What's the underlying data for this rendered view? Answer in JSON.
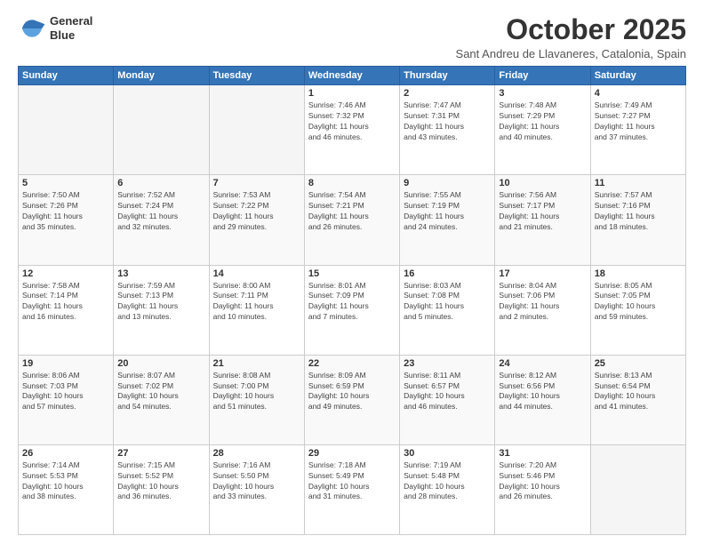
{
  "header": {
    "logo_line1": "General",
    "logo_line2": "Blue",
    "month": "October 2025",
    "location": "Sant Andreu de Llavaneres, Catalonia, Spain"
  },
  "weekdays": [
    "Sunday",
    "Monday",
    "Tuesday",
    "Wednesday",
    "Thursday",
    "Friday",
    "Saturday"
  ],
  "weeks": [
    [
      {
        "day": "",
        "info": ""
      },
      {
        "day": "",
        "info": ""
      },
      {
        "day": "",
        "info": ""
      },
      {
        "day": "1",
        "info": "Sunrise: 7:46 AM\nSunset: 7:32 PM\nDaylight: 11 hours\nand 46 minutes."
      },
      {
        "day": "2",
        "info": "Sunrise: 7:47 AM\nSunset: 7:31 PM\nDaylight: 11 hours\nand 43 minutes."
      },
      {
        "day": "3",
        "info": "Sunrise: 7:48 AM\nSunset: 7:29 PM\nDaylight: 11 hours\nand 40 minutes."
      },
      {
        "day": "4",
        "info": "Sunrise: 7:49 AM\nSunset: 7:27 PM\nDaylight: 11 hours\nand 37 minutes."
      }
    ],
    [
      {
        "day": "5",
        "info": "Sunrise: 7:50 AM\nSunset: 7:26 PM\nDaylight: 11 hours\nand 35 minutes."
      },
      {
        "day": "6",
        "info": "Sunrise: 7:52 AM\nSunset: 7:24 PM\nDaylight: 11 hours\nand 32 minutes."
      },
      {
        "day": "7",
        "info": "Sunrise: 7:53 AM\nSunset: 7:22 PM\nDaylight: 11 hours\nand 29 minutes."
      },
      {
        "day": "8",
        "info": "Sunrise: 7:54 AM\nSunset: 7:21 PM\nDaylight: 11 hours\nand 26 minutes."
      },
      {
        "day": "9",
        "info": "Sunrise: 7:55 AM\nSunset: 7:19 PM\nDaylight: 11 hours\nand 24 minutes."
      },
      {
        "day": "10",
        "info": "Sunrise: 7:56 AM\nSunset: 7:17 PM\nDaylight: 11 hours\nand 21 minutes."
      },
      {
        "day": "11",
        "info": "Sunrise: 7:57 AM\nSunset: 7:16 PM\nDaylight: 11 hours\nand 18 minutes."
      }
    ],
    [
      {
        "day": "12",
        "info": "Sunrise: 7:58 AM\nSunset: 7:14 PM\nDaylight: 11 hours\nand 16 minutes."
      },
      {
        "day": "13",
        "info": "Sunrise: 7:59 AM\nSunset: 7:13 PM\nDaylight: 11 hours\nand 13 minutes."
      },
      {
        "day": "14",
        "info": "Sunrise: 8:00 AM\nSunset: 7:11 PM\nDaylight: 11 hours\nand 10 minutes."
      },
      {
        "day": "15",
        "info": "Sunrise: 8:01 AM\nSunset: 7:09 PM\nDaylight: 11 hours\nand 7 minutes."
      },
      {
        "day": "16",
        "info": "Sunrise: 8:03 AM\nSunset: 7:08 PM\nDaylight: 11 hours\nand 5 minutes."
      },
      {
        "day": "17",
        "info": "Sunrise: 8:04 AM\nSunset: 7:06 PM\nDaylight: 11 hours\nand 2 minutes."
      },
      {
        "day": "18",
        "info": "Sunrise: 8:05 AM\nSunset: 7:05 PM\nDaylight: 10 hours\nand 59 minutes."
      }
    ],
    [
      {
        "day": "19",
        "info": "Sunrise: 8:06 AM\nSunset: 7:03 PM\nDaylight: 10 hours\nand 57 minutes."
      },
      {
        "day": "20",
        "info": "Sunrise: 8:07 AM\nSunset: 7:02 PM\nDaylight: 10 hours\nand 54 minutes."
      },
      {
        "day": "21",
        "info": "Sunrise: 8:08 AM\nSunset: 7:00 PM\nDaylight: 10 hours\nand 51 minutes."
      },
      {
        "day": "22",
        "info": "Sunrise: 8:09 AM\nSunset: 6:59 PM\nDaylight: 10 hours\nand 49 minutes."
      },
      {
        "day": "23",
        "info": "Sunrise: 8:11 AM\nSunset: 6:57 PM\nDaylight: 10 hours\nand 46 minutes."
      },
      {
        "day": "24",
        "info": "Sunrise: 8:12 AM\nSunset: 6:56 PM\nDaylight: 10 hours\nand 44 minutes."
      },
      {
        "day": "25",
        "info": "Sunrise: 8:13 AM\nSunset: 6:54 PM\nDaylight: 10 hours\nand 41 minutes."
      }
    ],
    [
      {
        "day": "26",
        "info": "Sunrise: 7:14 AM\nSunset: 5:53 PM\nDaylight: 10 hours\nand 38 minutes."
      },
      {
        "day": "27",
        "info": "Sunrise: 7:15 AM\nSunset: 5:52 PM\nDaylight: 10 hours\nand 36 minutes."
      },
      {
        "day": "28",
        "info": "Sunrise: 7:16 AM\nSunset: 5:50 PM\nDaylight: 10 hours\nand 33 minutes."
      },
      {
        "day": "29",
        "info": "Sunrise: 7:18 AM\nSunset: 5:49 PM\nDaylight: 10 hours\nand 31 minutes."
      },
      {
        "day": "30",
        "info": "Sunrise: 7:19 AM\nSunset: 5:48 PM\nDaylight: 10 hours\nand 28 minutes."
      },
      {
        "day": "31",
        "info": "Sunrise: 7:20 AM\nSunset: 5:46 PM\nDaylight: 10 hours\nand 26 minutes."
      },
      {
        "day": "",
        "info": ""
      }
    ]
  ]
}
